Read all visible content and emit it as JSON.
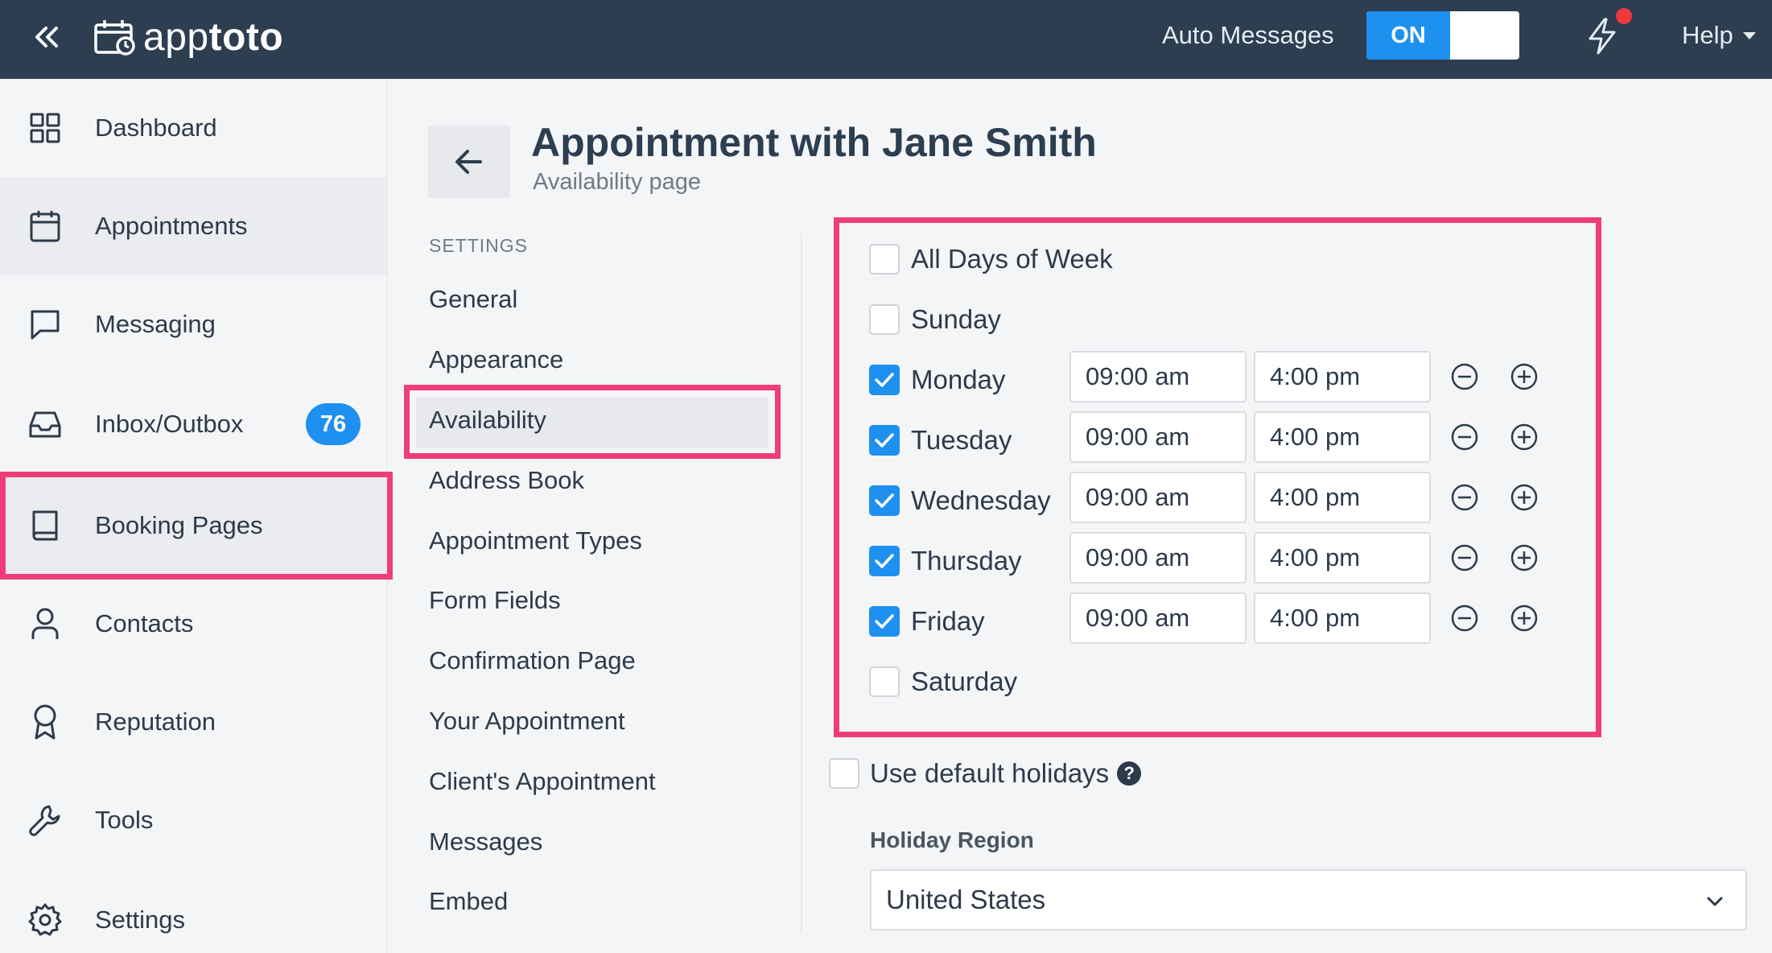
{
  "topbar": {
    "logo_light": "app",
    "logo_bold": "toto",
    "auto_messages_label": "Auto Messages",
    "auto_messages_state": "ON",
    "help_label": "Help"
  },
  "sidebar": {
    "items": [
      {
        "label": "Dashboard",
        "icon": "grid-icon"
      },
      {
        "label": "Appointments",
        "icon": "calendar-icon"
      },
      {
        "label": "Messaging",
        "icon": "chat-icon"
      },
      {
        "label": "Inbox/Outbox",
        "icon": "inbox-icon",
        "badge": "76"
      },
      {
        "label": "Booking Pages",
        "icon": "book-icon",
        "active": true
      },
      {
        "label": "Contacts",
        "icon": "user-icon"
      },
      {
        "label": "Reputation",
        "icon": "award-icon"
      },
      {
        "label": "Tools",
        "icon": "wrench-icon"
      },
      {
        "label": "Settings",
        "icon": "gear-icon"
      }
    ]
  },
  "header": {
    "title": "Appointment with Jane Smith",
    "subtitle": "Availability page"
  },
  "settings_nav": {
    "heading": "SETTINGS",
    "items": [
      "General",
      "Appearance",
      "Availability",
      "Address Book",
      "Appointment Types",
      "Form Fields",
      "Confirmation Page",
      "Your Appointment",
      "Client's Appointment",
      "Messages",
      "Embed"
    ],
    "active": "Availability"
  },
  "availability": {
    "all_days_label": "All Days of Week",
    "days": [
      {
        "label": "Sunday",
        "checked": false
      },
      {
        "label": "Monday",
        "checked": true,
        "start": "09:00 am",
        "end": "4:00 pm"
      },
      {
        "label": "Tuesday",
        "checked": true,
        "start": "09:00 am",
        "end": "4:00 pm"
      },
      {
        "label": "Wednesday",
        "checked": true,
        "start": "09:00 am",
        "end": "4:00 pm"
      },
      {
        "label": "Thursday",
        "checked": true,
        "start": "09:00 am",
        "end": "4:00 pm"
      },
      {
        "label": "Friday",
        "checked": true,
        "start": "09:00 am",
        "end": "4:00 pm"
      },
      {
        "label": "Saturday",
        "checked": false
      }
    ]
  },
  "holidays": {
    "use_default_label": "Use default holidays",
    "help_glyph": "?",
    "region_label": "Holiday Region",
    "region_value": "United States"
  },
  "colors": {
    "topbar": "#2c3e50",
    "accent": "#1e90ef",
    "highlight": "#ee3d7a",
    "badge": "#1e90ef",
    "notification_dot": "#f0383e"
  }
}
